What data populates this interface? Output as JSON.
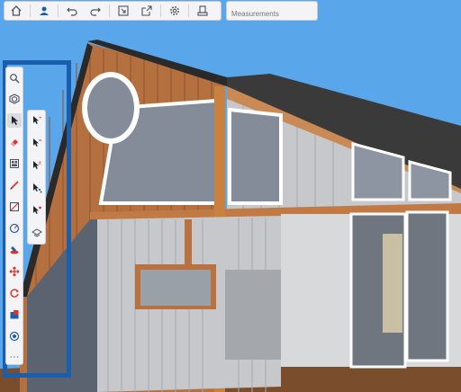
{
  "measurements": {
    "placeholder": "Measurements"
  },
  "toolbar": {
    "items": [
      "home-icon",
      "user-icon",
      "undo-icon",
      "redo-icon",
      "import-icon",
      "export-icon",
      "settings-icon",
      "print-icon"
    ]
  },
  "tools": [
    "search-icon",
    "orbit-icon",
    "select-icon",
    "eraser-icon",
    "warehouse-icon",
    "pencil-icon",
    "line-icon",
    "compass-icon",
    "paint-bucket-icon",
    "move-icon",
    "rotate-icon",
    "push-pull-icon",
    "tape-icon",
    "more-icon"
  ],
  "sub_tools": [
    "select-add-icon",
    "select-subtract-icon",
    "select-toggle-icon",
    "select-all-icon",
    "select-paint-icon",
    "section-icon"
  ],
  "colors": {
    "sky": "#5aa6ea",
    "highlight": "#1a5fad",
    "toolbar_bg": "#f4f4f6",
    "accent_red": "#e0322a"
  }
}
